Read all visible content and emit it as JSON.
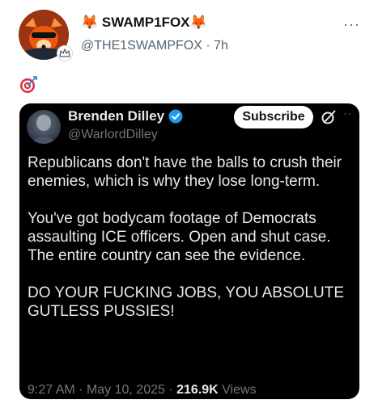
{
  "post": {
    "display_name": "🦊 SWAMP1FOX🦊",
    "handle": "@THE1SWAMPFOX",
    "separator": "·",
    "time": "7h",
    "more_label": "···",
    "emoji": "🎯",
    "avatar_icon": "fox-avatar",
    "badge_icon": "crown-badge-icon"
  },
  "embedded": {
    "name": "Brenden Dilley",
    "handle": "@WarlordDilley",
    "verified_color": "#1d9bf0",
    "subscribe_label": "Subscribe",
    "more_label": "··",
    "paragraphs": [
      "Republicans don't have the balls to crush their enemies, which is why they lose long-term.",
      "You've got bodycam footage of Democrats assaulting ICE officers. Open and shut case. The entire country can see the evidence.",
      "DO YOUR FUCKING JOBS, YOU ABSOLUTE GUTLESS PUSSIES!"
    ],
    "time": "9:27 AM",
    "date": "May 10, 2025",
    "views_count": "216.9K",
    "views_label": "Views",
    "sep": "·"
  }
}
